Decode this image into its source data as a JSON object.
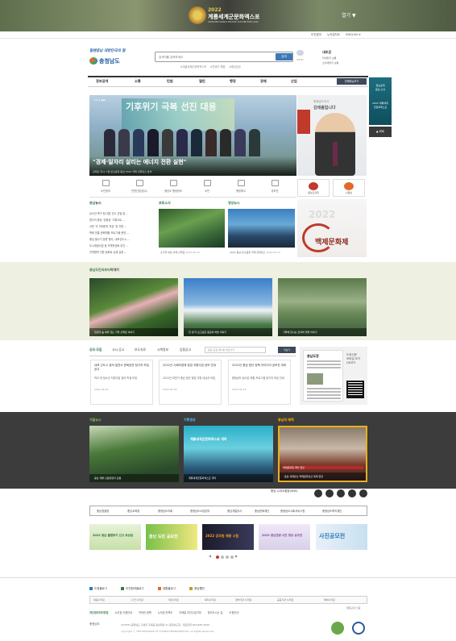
{
  "banner": {
    "year": "2022",
    "title": "계룡세계군문화엑스포",
    "subtitle": "GYERYONG WORLD MILITARY CULTURE EXPO 2022",
    "open_label": "열기 ▼"
  },
  "top_links": [
    "도민참여",
    "누리집지도",
    "ENGLISH ▾"
  ],
  "header": {
    "slogan": "힘쎈충남 대한민국의 힘",
    "logo_text": "충청남도",
    "search_placeholder": "검색어를 입력하세요",
    "search_button": "검색",
    "keywords": [
      "#계룡세계군문화엑스포",
      "#민생기 해결",
      "#충남공공"
    ],
    "weather": {
      "label": "7.1°C",
      "sub": "맑음",
      "title": "내포권",
      "line1": "미세먼지 보통",
      "line2": "초미세먼지 보통"
    }
  },
  "gnb": {
    "items": [
      "정보공개",
      "소통",
      "민원",
      "열린",
      "행정",
      "경제",
      "산업",
      "충남소개"
    ],
    "all_menu": "전체메뉴보기"
  },
  "side_banner": {
    "text1": "정보공개",
    "text2": "충남 소식",
    "text3": "2022 계룡세계",
    "text4": "군문화엑스포",
    "close": "▲ 위로"
  },
  "main_visual": {
    "headline": "\"경제·일자리 살리는 에너지 전환 실현\"",
    "summary": "김태흠 지사, 7일 탄소중립 충남 2022 국제 컨퍼런스 참석",
    "big_text": "기후위기 극복 선진 대응",
    "controls": "1/5 ‖ ◀ ▶"
  },
  "governor": {
    "label": "충청남도지사",
    "name": "김태흠입니다"
  },
  "quick_links": [
    "도민참여",
    "민원신청(접수)",
    "충남도 행정정보",
    "도민",
    "행정예고",
    "공모전"
  ],
  "quick_right": [
    "충남도의회",
    "나충남"
  ],
  "news": {
    "title_prefix": "충남",
    "title_rest": "뉴스",
    "items": [
      "유소년 축구 팀 대표 선수 선발 및 …",
      "원주의 충남 '유충상' 기록으로 …",
      "서천 '초 미세먼지 저감' 및 지원 …",
      "백제 전통 문화체험 프로그램 운영 …",
      "충남 물고기 방류 행사, 내포신도시 …",
      "도시재생사업 등 지역활성화 추진 …",
      "지역협력 지원 강화로 상생 실현 …"
    ]
  },
  "photo_news": {
    "title": "포토소식",
    "caption": "초가을 하늘 아래 산책로",
    "date": "2022.09.19"
  },
  "video_news": {
    "title": "영상뉴스",
    "caption": "2022 충남 탄소중립 국제 컨퍼런스",
    "date": "2022.09.19"
  },
  "baekje": {
    "year": "2022",
    "title": "백제문화제"
  },
  "story": {
    "title_prefix": "충남도민리포터",
    "title_rest": "이야기",
    "items": [
      "천년의 숲 속을 걷는 가을 산책로 이야기",
      "한 번 더 보고싶은 충남의 하늘 이야기",
      "가을에 만나는 습지와 연꽃 이야기"
    ]
  },
  "tabs": {
    "items": [
      "공모·모집",
      "고시·공고",
      "보도자료",
      "시책정보",
      "입찰공고"
    ],
    "select": "공모·모집 게시판 바로가기",
    "button": "더보기"
  },
  "cards": [
    {
      "head": "내포 신도시 꿈의 발전소 문화공연 참가자 모집 공고",
      "desc": "학교 밖 청소년 지원사업 참여 학생 모집",
      "date": "2022-09-19"
    },
    {
      "head": "2022년 사회적경제 창업 지원사업 공모 안내",
      "desc": "2022년 하반기 충남 청년 창업 지원 대상자 모집",
      "date": "2022-09-16"
    },
    {
      "head": "2022년 충남 청년 정책 아이디어 공모전 개최",
      "desc": "충청남도 농어촌 체험 프로그램 참가자 모집 안내",
      "date": "2022-09-14"
    }
  ],
  "paper": {
    "title": "충남도정",
    "desc1": "도정신문",
    "desc2": "모바일 보기",
    "desc3": "QR코드"
  },
  "dark": {
    "t1": "가을뉴스",
    "t2": "기획영상",
    "t3": "충남의 매력",
    "cap1": "충남 계룡 산림휴양지 단풍",
    "cap2": "계룡세계군문화엑스포 개막",
    "cap3": "충남 세계유산 백제문화유산 축제 현장",
    "t2_text": "계룡세계군문화엑스포 개막",
    "t3_text": "백제문화제 개막 현장"
  },
  "sns_label": "충남 누리소통망(SNS)",
  "orgs": [
    "충남경찰청",
    "충남교육청",
    "충청남도의회",
    "충청남도소방본부",
    "충남개발공사",
    "충남문화재단",
    "충청남도사회서비스원",
    "충청남도복지재단"
  ],
  "promos": [
    "2022 충남 불법투기 신고 포상금",
    "충남 도민 공모전",
    "2022 공무원 채용 시험",
    "2022 충남관광 사진 영상 공모전",
    "사진공모전"
  ],
  "blogs": [
    "도정블로그",
    "도민참여블로그",
    "생활블로그",
    "충남웹진"
  ],
  "sites": [
    "대표누리집",
    "시·군 누리집",
    "기관누리집",
    "복지누리집",
    "정부기관 누리집",
    "공공기관 누리집",
    "해외누리집"
  ],
  "footer_links": [
    "개인정보처리방침",
    "누리집 이용안내",
    "저작권 정책",
    "누리집 만족도",
    "이메일 무단수집거부",
    "찾아오시는 길",
    "도청안내"
  ],
  "footer": {
    "logo": "충청남도",
    "address": "(32255) 충청남도 홍성군 홍북읍 충남대로 21 충청남도청 · 대표전화 041)635-2000",
    "copyright": "copyright ⓒ THE PROVINCE OF CHUNGCHEONGNAM-DO. All Rights Reserved.",
    "wa": "웹접근성 인증"
  }
}
